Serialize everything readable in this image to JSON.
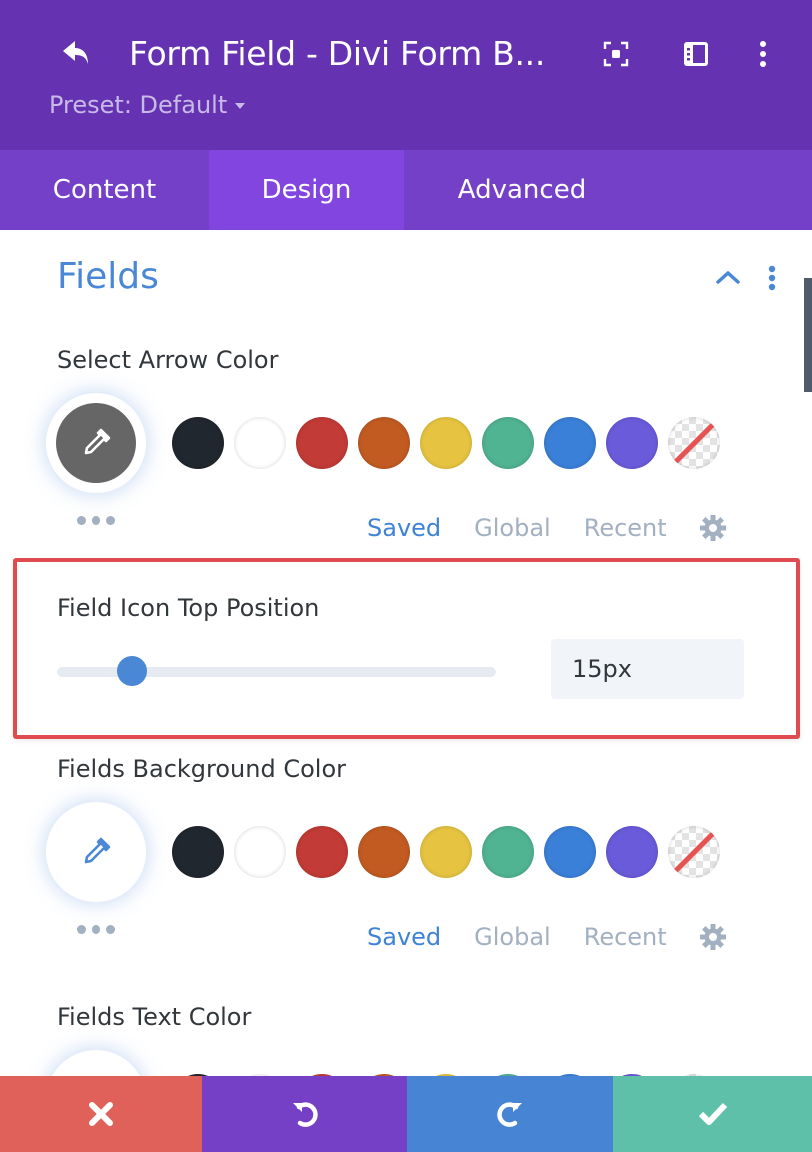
{
  "header": {
    "title": "Form Field - Divi Form B...",
    "preset_label": "Preset: Default",
    "background": "#6533b1",
    "icons": [
      "back-arrow-icon",
      "focus-screen-icon",
      "sidebar-layout-icon",
      "more-vertical-icon"
    ]
  },
  "tabs": [
    {
      "label": "Content",
      "active": false
    },
    {
      "label": "Design",
      "active": true
    },
    {
      "label": "Advanced",
      "active": false
    }
  ],
  "section": {
    "title": "Fields",
    "expanded": true
  },
  "palette": {
    "swatches": [
      {
        "name": "dark",
        "color": "#21272e"
      },
      {
        "name": "white",
        "color": "#ffffff"
      },
      {
        "name": "red",
        "color": "#c23b36"
      },
      {
        "name": "orange",
        "color": "#c15b22"
      },
      {
        "name": "yellow",
        "color": "#e6c441"
      },
      {
        "name": "green",
        "color": "#50b391"
      },
      {
        "name": "blue",
        "color": "#3a80d8"
      },
      {
        "name": "purple",
        "color": "#6a5bdb"
      },
      {
        "name": "transparent",
        "color": "transparent"
      }
    ],
    "tabs": {
      "saved": "Saved",
      "global": "Global",
      "recent": "Recent"
    },
    "active_tab": "Saved"
  },
  "settings": {
    "select_arrow_color": {
      "label": "Select Arrow Color",
      "current_color": "#666666"
    },
    "field_icon_top_position": {
      "label": "Field Icon Top Position",
      "value": "15px",
      "slider_fraction": 0.17,
      "highlighted": true
    },
    "fields_background_color": {
      "label": "Fields Background Color",
      "current_color": "#ffffff"
    },
    "fields_text_color": {
      "label": "Fields Text Color"
    }
  },
  "footer": {
    "buttons": [
      {
        "name": "discard",
        "icon": "close-icon",
        "color": "#e0605a"
      },
      {
        "name": "undo",
        "icon": "undo-icon",
        "color": "#7540c6"
      },
      {
        "name": "redo",
        "icon": "redo-icon",
        "color": "#4784d4"
      },
      {
        "name": "save",
        "icon": "check-icon",
        "color": "#5ec0a8"
      }
    ]
  }
}
